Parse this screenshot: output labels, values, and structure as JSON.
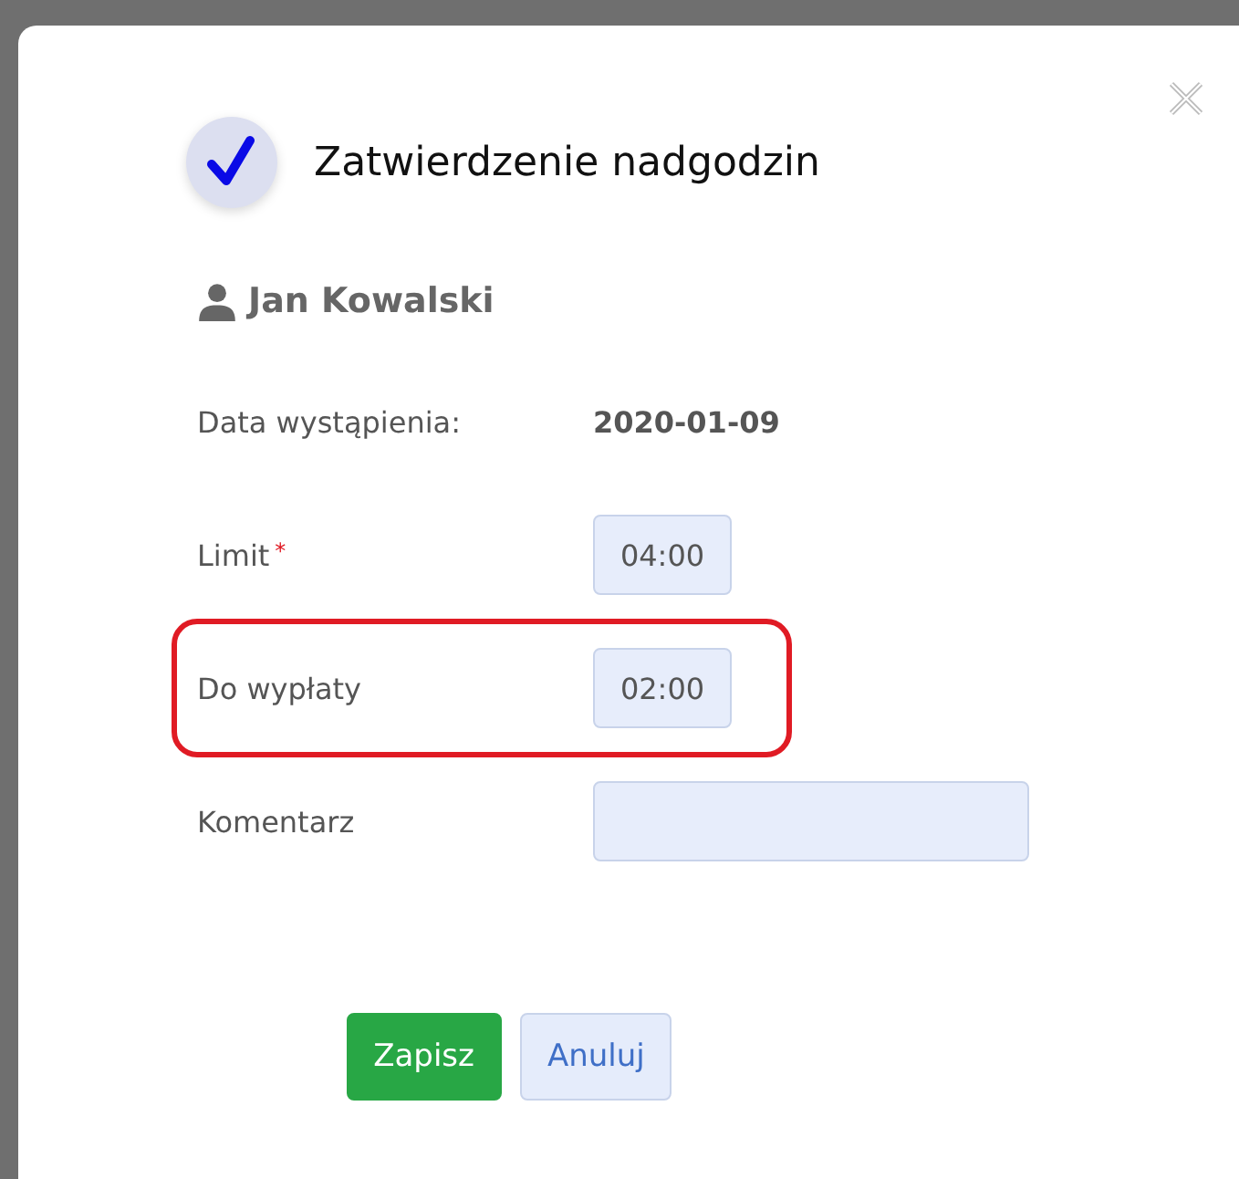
{
  "dialog": {
    "title": "Zatwierdzenie nadgodzin",
    "person": "Jan Kowalski"
  },
  "fields": [
    {
      "kind": "text",
      "label": "Data wystąpienia:",
      "value": "2020-01-09",
      "highlighted": false
    },
    {
      "kind": "time",
      "label": "Limit",
      "required_mark": "*",
      "value": "04:00",
      "highlighted": false
    },
    {
      "kind": "time",
      "label": "Do wypłaty",
      "value": "02:00",
      "highlighted": true
    },
    {
      "kind": "wide",
      "label": "Komentarz",
      "highlighted": false
    }
  ],
  "buttons": [
    {
      "label": "Zapisz",
      "kind": "primary"
    },
    {
      "label": "Anuluj",
      "kind": "secondary"
    }
  ]
}
